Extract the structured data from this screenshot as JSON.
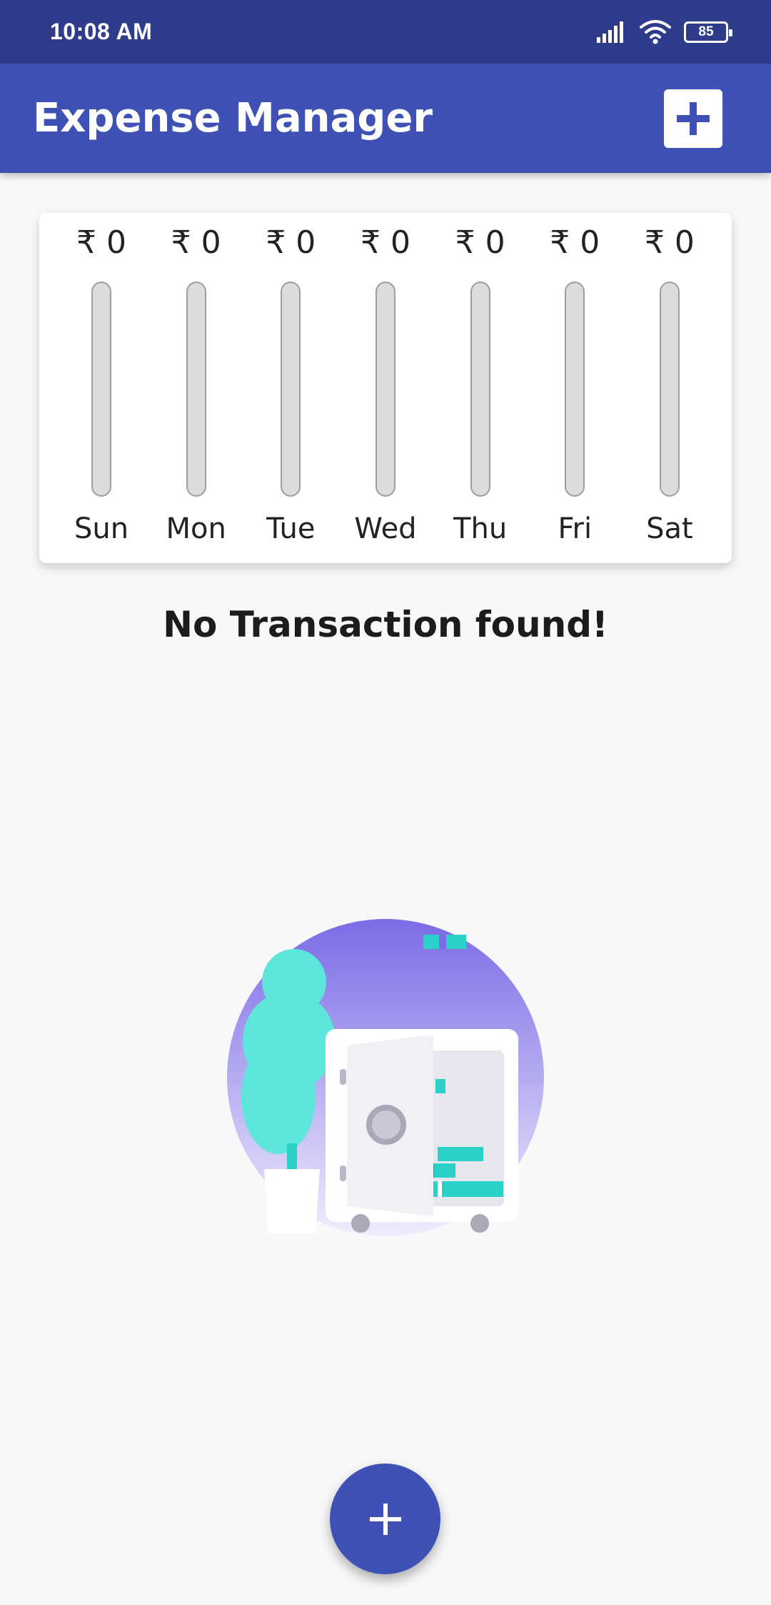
{
  "status_bar": {
    "time": "10:08 AM",
    "battery": "85",
    "icons": [
      "signal-icon",
      "wifi-icon",
      "battery-icon"
    ]
  },
  "app_bar": {
    "title": "Expense Manager",
    "action_icon": "plus-icon"
  },
  "chart": {
    "currency": "₹",
    "days": [
      {
        "label": "Sun",
        "amount": "₹ 0",
        "fill": 0
      },
      {
        "label": "Mon",
        "amount": "₹ 0",
        "fill": 0
      },
      {
        "label": "Tue",
        "amount": "₹ 0",
        "fill": 0
      },
      {
        "label": "Wed",
        "amount": "₹ 0",
        "fill": 0
      },
      {
        "label": "Thu",
        "amount": "₹ 0",
        "fill": 0
      },
      {
        "label": "Fri",
        "amount": "₹ 0",
        "fill": 0
      },
      {
        "label": "Sat",
        "amount": "₹ 0",
        "fill": 0
      }
    ]
  },
  "empty_state": {
    "message": "No Transaction found!",
    "illustration": "empty-safe-illustration"
  },
  "fab": {
    "icon": "plus-icon"
  },
  "colors": {
    "primary": "#3f51b5",
    "status_bar": "#2f3c8c",
    "background": "#f8f8fa",
    "bar_track": "#dcdcdc",
    "accent_teal": "#5ee6dc",
    "accent_purple": "#7b6be6"
  }
}
